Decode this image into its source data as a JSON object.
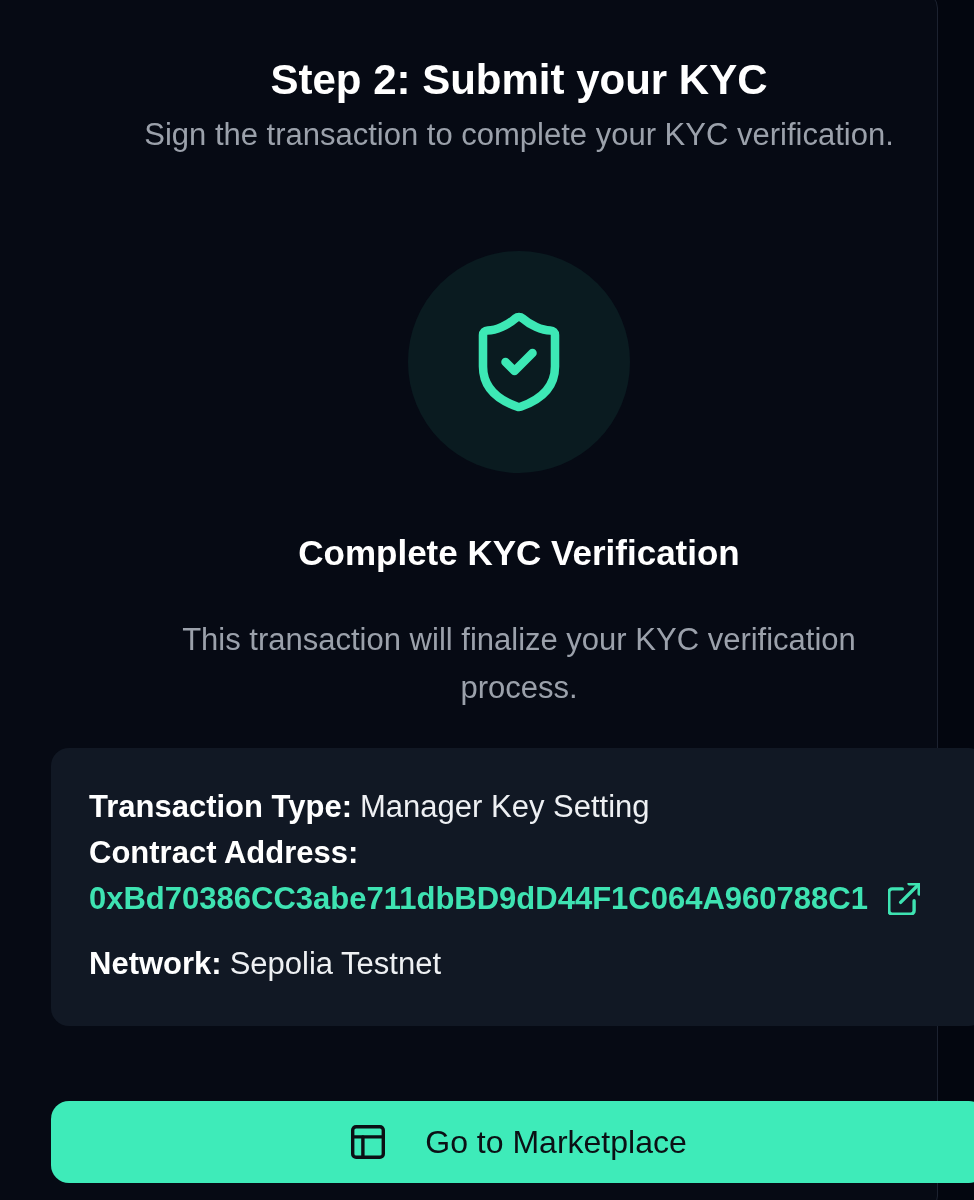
{
  "header": {
    "title": "Step 2: Submit your KYC",
    "subtitle": "Sign the transaction to complete your KYC verification."
  },
  "status": {
    "heading": "Complete KYC Verification",
    "description": "This transaction will finalize your KYC verification process."
  },
  "details": [
    {
      "kind": "text",
      "label": "Transaction Type:",
      "value": "Manager Key Setting"
    },
    {
      "kind": "address",
      "label": "Contract Address:",
      "value": "0xBd70386CC3abe711dbBD9dD44F1C064A960788C1"
    },
    {
      "kind": "text",
      "label": "Network:",
      "value": "Sepolia Testnet"
    }
  ],
  "action": {
    "label": "Go to Marketplace"
  }
}
